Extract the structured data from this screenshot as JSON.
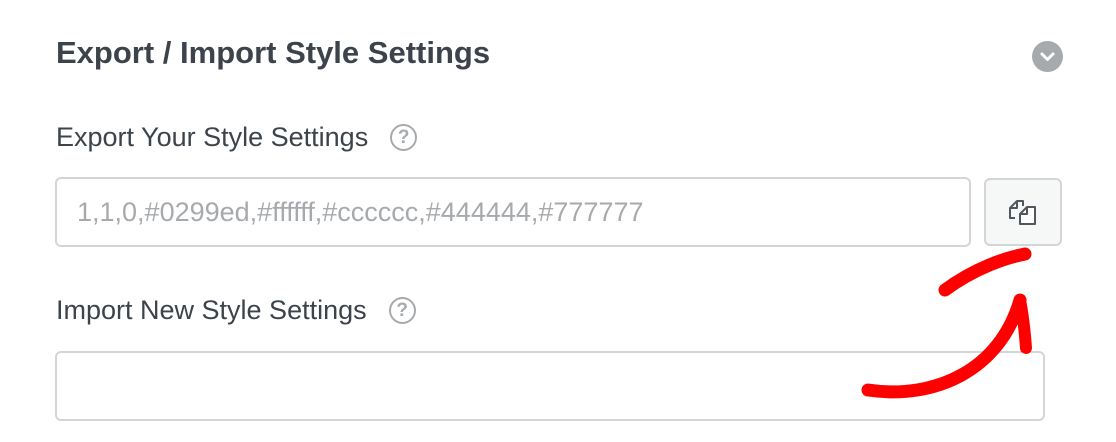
{
  "section": {
    "title": "Export / Import Style Settings",
    "toggle_icon": "chevron-down-circle-icon"
  },
  "export": {
    "label": "Export Your Style Settings",
    "help_icon": "question-circle-icon",
    "help_glyph": "?",
    "value": "1,1,0,#0299ed,#ffffff,#cccccc,#444444,#777777",
    "copy_icon": "copy-icon"
  },
  "import": {
    "label": "Import New Style Settings",
    "help_icon": "question-circle-icon",
    "help_glyph": "?",
    "value": "",
    "placeholder": ""
  },
  "annotation": {
    "icon": "red-hand-drawn-arrow",
    "color": "#ff0000"
  },
  "colors": {
    "text": "#3c434a",
    "muted": "#a7aaad",
    "border": "#d3d5d7",
    "button_bg": "#f6f7f7"
  }
}
